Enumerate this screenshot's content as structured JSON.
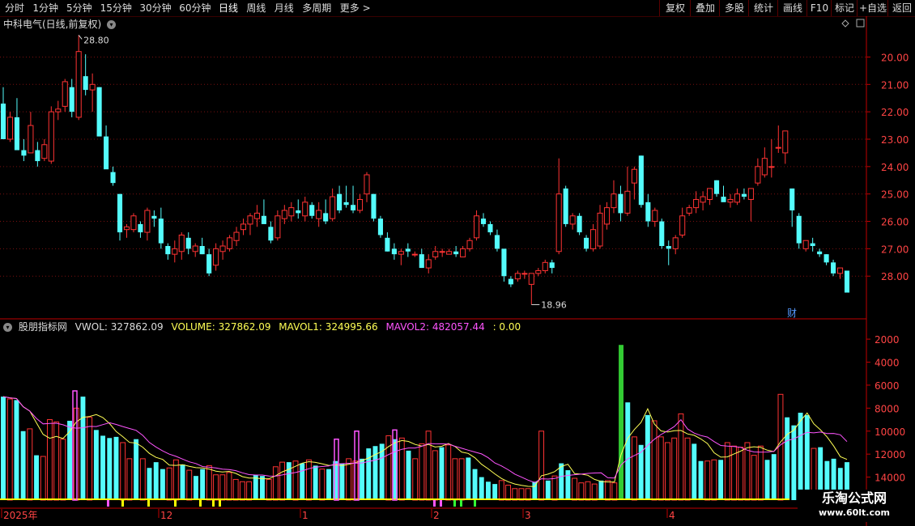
{
  "toolbar": {
    "periods": [
      "分时",
      "1分钟",
      "5分钟",
      "15分钟",
      "30分钟",
      "60分钟",
      "日线",
      "周线",
      "月线",
      "多周期",
      "更多"
    ],
    "active": "日线",
    "right_buttons": [
      "复权",
      "叠加",
      "多股",
      "统计",
      "画线",
      "F10",
      "标记",
      "+自选",
      "返回"
    ]
  },
  "main_chart": {
    "title": "中科电气(日线,前复权)",
    "high_label": "28.80",
    "low_label": "18.96",
    "badge": "财",
    "price_ticks": [
      "28.00",
      "27.00",
      "26.00",
      "25.00",
      "24.00",
      "23.00",
      "22.00",
      "21.00",
      "20.00"
    ]
  },
  "indicator": {
    "name": "股朋指标网",
    "vwol": "VWOL: 327862.09",
    "volume": "VOLUME: 327862.09",
    "mavol1": "MAVOL1: 324995.66",
    "mavol2": "MAVOL2: 482057.44",
    "extra": ": 0.00",
    "vol_ticks": [
      "14000",
      "12000",
      "10000",
      "8000",
      "6000",
      "4000",
      "2000"
    ]
  },
  "time_axis": {
    "labels": [
      "2025年",
      "12",
      "1",
      "2",
      "3",
      "4"
    ]
  },
  "watermark": {
    "title": "乐淘公式网",
    "url": "www.60lt.com"
  },
  "colors": {
    "up": "#ff3333",
    "down": "#54fcfc",
    "ma1": "#ffff55",
    "ma2": "#ff55ff",
    "grid": "#7a1010",
    "axis": "#c00000",
    "text": "#dddddd"
  },
  "chart_data": [
    {
      "type": "candlestick",
      "title": "中科电气(日线,前复权)",
      "ylim": [
        18.5,
        28.9
      ],
      "y_ticks": [
        20,
        21,
        22,
        23,
        24,
        25,
        26,
        27,
        28
      ],
      "x_labels": [
        "2025年",
        "12",
        "1",
        "2",
        "3",
        "4"
      ],
      "ohlc": [
        [
          26.3,
          26.9,
          25.0,
          25.0
        ],
        [
          25.0,
          26.0,
          24.9,
          25.8
        ],
        [
          25.8,
          26.5,
          24.6,
          24.6
        ],
        [
          24.6,
          25.0,
          24.2,
          24.4
        ],
        [
          24.5,
          26.0,
          24.5,
          25.5
        ],
        [
          24.6,
          24.9,
          24.0,
          24.2
        ],
        [
          24.3,
          25.0,
          24.2,
          24.8
        ],
        [
          24.2,
          26.2,
          24.1,
          26.0
        ],
        [
          26.0,
          26.4,
          25.7,
          26.1
        ],
        [
          26.2,
          27.2,
          26.0,
          27.1
        ],
        [
          26.9,
          27.2,
          25.8,
          26.0
        ],
        [
          25.8,
          28.8,
          25.7,
          28.2
        ],
        [
          27.3,
          28.1,
          26.6,
          26.8
        ],
        [
          26.8,
          27.4,
          26.0,
          27.0
        ],
        [
          26.9,
          26.9,
          25.2,
          25.1
        ],
        [
          25.1,
          25.5,
          24.1,
          23.9
        ],
        [
          23.8,
          24.0,
          23.3,
          23.4
        ],
        [
          23.0,
          23.0,
          21.3,
          21.6
        ],
        [
          21.7,
          21.9,
          21.4,
          21.8
        ],
        [
          21.7,
          22.3,
          21.6,
          22.2
        ],
        [
          21.9,
          22.0,
          21.4,
          21.6
        ],
        [
          21.6,
          22.5,
          21.3,
          22.4
        ],
        [
          22.2,
          22.4,
          21.8,
          22.1
        ],
        [
          22.1,
          22.5,
          21.0,
          21.2
        ],
        [
          21.1,
          21.2,
          20.6,
          20.8
        ],
        [
          20.8,
          21.3,
          20.5,
          21.0
        ],
        [
          20.9,
          21.6,
          20.6,
          21.5
        ],
        [
          21.4,
          21.6,
          20.8,
          21.0
        ],
        [
          20.9,
          21.2,
          20.7,
          21.1
        ],
        [
          21.1,
          21.4,
          20.8,
          20.8
        ],
        [
          20.8,
          21.0,
          20.0,
          20.1
        ],
        [
          20.4,
          21.2,
          20.2,
          21.0
        ],
        [
          20.9,
          21.3,
          20.6,
          21.1
        ],
        [
          21.0,
          21.5,
          20.9,
          21.4
        ],
        [
          21.3,
          21.8,
          21.1,
          21.6
        ],
        [
          21.7,
          22.1,
          21.5,
          21.9
        ],
        [
          21.9,
          22.3,
          21.5,
          22.2
        ],
        [
          22.1,
          22.6,
          21.8,
          22.3
        ],
        [
          22.2,
          22.8,
          21.9,
          21.9
        ],
        [
          21.8,
          22.0,
          21.2,
          21.3
        ],
        [
          21.4,
          22.4,
          21.3,
          22.2
        ],
        [
          22.1,
          22.6,
          21.9,
          22.4
        ],
        [
          22.2,
          22.7,
          22.0,
          22.5
        ],
        [
          22.4,
          22.8,
          22.1,
          22.3
        ],
        [
          22.2,
          22.9,
          22.0,
          22.7
        ],
        [
          22.6,
          22.7,
          22.1,
          22.2
        ],
        [
          22.1,
          22.7,
          21.8,
          22.4
        ],
        [
          22.3,
          22.8,
          21.9,
          22.0
        ],
        [
          22.1,
          23.2,
          22.0,
          22.9
        ],
        [
          23.0,
          23.3,
          22.3,
          22.4
        ],
        [
          22.7,
          23.3,
          22.5,
          22.6
        ],
        [
          22.6,
          23.3,
          22.3,
          22.4
        ],
        [
          22.4,
          23.0,
          22.3,
          22.8
        ],
        [
          23.0,
          23.8,
          22.7,
          23.7
        ],
        [
          23.0,
          23.0,
          22.0,
          22.1
        ],
        [
          22.1,
          22.2,
          21.4,
          21.5
        ],
        [
          21.4,
          21.6,
          20.9,
          20.9
        ],
        [
          21.0,
          21.2,
          20.6,
          20.8
        ],
        [
          20.8,
          21.0,
          20.4,
          20.9
        ],
        [
          21.0,
          21.2,
          20.7,
          20.9
        ],
        [
          20.8,
          20.9,
          20.7,
          20.8
        ],
        [
          20.8,
          21.0,
          20.3,
          20.3
        ],
        [
          20.3,
          20.8,
          20.1,
          20.6
        ],
        [
          20.7,
          21.1,
          20.6,
          20.9
        ],
        [
          20.9,
          21.0,
          20.7,
          20.9
        ],
        [
          20.8,
          21.0,
          20.8,
          20.9
        ],
        [
          20.9,
          21.1,
          20.7,
          20.8
        ],
        [
          20.7,
          21.1,
          20.7,
          21.0
        ],
        [
          21.0,
          21.4,
          20.9,
          21.3
        ],
        [
          21.4,
          22.4,
          21.3,
          22.2
        ],
        [
          22.1,
          22.3,
          21.8,
          21.9
        ],
        [
          21.9,
          22.0,
          21.5,
          21.6
        ],
        [
          21.5,
          21.7,
          20.9,
          21.0
        ],
        [
          21.0,
          21.0,
          19.8,
          20.0
        ],
        [
          19.9,
          20.0,
          19.6,
          19.7
        ],
        [
          19.9,
          20.2,
          19.8,
          20.1
        ],
        [
          20.1,
          20.2,
          19.9,
          20.1
        ],
        [
          19.7,
          20.1,
          18.96,
          20.1
        ],
        [
          20.1,
          20.3,
          20.0,
          20.2
        ],
        [
          20.2,
          20.6,
          20.1,
          20.5
        ],
        [
          20.5,
          20.6,
          20.1,
          20.3
        ],
        [
          20.9,
          24.3,
          20.8,
          23.0
        ],
        [
          23.2,
          23.3,
          21.8,
          21.9
        ],
        [
          21.9,
          22.3,
          21.7,
          22.2
        ],
        [
          22.2,
          22.3,
          21.5,
          21.6
        ],
        [
          21.4,
          21.5,
          20.9,
          21.0
        ],
        [
          21.0,
          21.9,
          20.9,
          21.7
        ],
        [
          21.1,
          22.6,
          21.0,
          22.3
        ],
        [
          21.9,
          22.7,
          21.7,
          22.5
        ],
        [
          22.5,
          23.5,
          22.3,
          23.0
        ],
        [
          23.0,
          23.3,
          22.0,
          22.3
        ],
        [
          22.3,
          24.0,
          22.2,
          23.1
        ],
        [
          23.4,
          24.0,
          22.8,
          23.9
        ],
        [
          24.4,
          24.4,
          22.5,
          22.6
        ],
        [
          22.7,
          23.0,
          21.8,
          22.0
        ],
        [
          22.0,
          22.5,
          21.8,
          22.4
        ],
        [
          22.0,
          22.1,
          21.0,
          21.1
        ],
        [
          21.1,
          21.3,
          20.4,
          21.0
        ],
        [
          21.0,
          21.5,
          20.8,
          21.4
        ],
        [
          21.5,
          22.5,
          21.4,
          22.2
        ],
        [
          22.3,
          22.6,
          22.2,
          22.5
        ],
        [
          22.5,
          23.1,
          22.3,
          22.8
        ],
        [
          22.7,
          23.1,
          22.4,
          22.9
        ],
        [
          22.8,
          23.2,
          22.6,
          23.2
        ],
        [
          23.5,
          23.5,
          22.9,
          23.0
        ],
        [
          22.9,
          23.3,
          22.8,
          22.7
        ],
        [
          22.7,
          23.0,
          22.5,
          22.8
        ],
        [
          22.7,
          23.2,
          22.6,
          23.0
        ],
        [
          23.0,
          23.2,
          22.8,
          22.9
        ],
        [
          22.8,
          23.2,
          22.0,
          23.2
        ],
        [
          23.4,
          24.3,
          23.3,
          24.0
        ],
        [
          23.7,
          24.7,
          23.6,
          24.3
        ],
        [
          24.0,
          25.0,
          23.6,
          24.0
        ],
        [
          24.7,
          25.5,
          24.5,
          24.7
        ],
        [
          24.5,
          25.0,
          24.1,
          25.3
        ],
        [
          23.2,
          23.2,
          21.8,
          22.4
        ],
        [
          22.2,
          22.3,
          21.0,
          21.2
        ],
        [
          21.0,
          21.3,
          20.9,
          21.3
        ],
        [
          21.2,
          21.4,
          20.9,
          21.1
        ],
        [
          20.9,
          21.0,
          20.7,
          20.8
        ],
        [
          20.8,
          20.8,
          20.4,
          20.5
        ],
        [
          20.5,
          20.6,
          20.0,
          20.1
        ],
        [
          20.1,
          20.3,
          19.9,
          20.3
        ],
        [
          20.2,
          20.2,
          19.4,
          19.4
        ]
      ]
    },
    {
      "type": "bar",
      "title": "股朋指标网",
      "ylim": [
        0,
        14500
      ],
      "y_ticks": [
        2000,
        4000,
        6000,
        8000,
        10000,
        12000,
        14000
      ],
      "values": [
        9000,
        8800,
        8700,
        6000,
        6200,
        3900,
        3800,
        7000,
        6800,
        5300,
        6900,
        8000,
        9000,
        7200,
        6100,
        5600,
        5400,
        5500,
        5000,
        3600,
        5300,
        3600,
        2800,
        3300,
        2700,
        2800,
        3500,
        3100,
        2600,
        2100,
        2700,
        3000,
        2200,
        2200,
        2400,
        1800,
        1600,
        1600,
        2200,
        2100,
        1800,
        2900,
        3300,
        3300,
        3400,
        3200,
        3500,
        3000,
        2700,
        2700,
        3400,
        3200,
        3600,
        3400,
        3600,
        4500,
        4700,
        4900,
        5600,
        5300,
        5400,
        4300,
        3600,
        4900,
        6000,
        4300,
        4600,
        4800,
        3600,
        3600,
        3700,
        2700,
        2000,
        1600,
        1400,
        1700,
        1300,
        1000,
        1000,
        1000,
        1600,
        6000,
        1700,
        2100,
        3200,
        2600,
        1900,
        1500,
        1600,
        1400,
        1700,
        1700,
        1500,
        13500,
        8500,
        5500,
        4800,
        7400,
        6900,
        5500,
        5000,
        5400,
        7500,
        5400,
        4900,
        3400,
        3400,
        3500,
        3500,
        5000,
        4700,
        4600,
        5000,
        3900,
        4700,
        3500,
        4000,
        9200,
        7200,
        6500,
        7600,
        7400,
        4500,
        4600,
        3400,
        3600,
        2800,
        3300
      ],
      "mavol1_start": 7600,
      "mavol2_start": 8200
    }
  ]
}
